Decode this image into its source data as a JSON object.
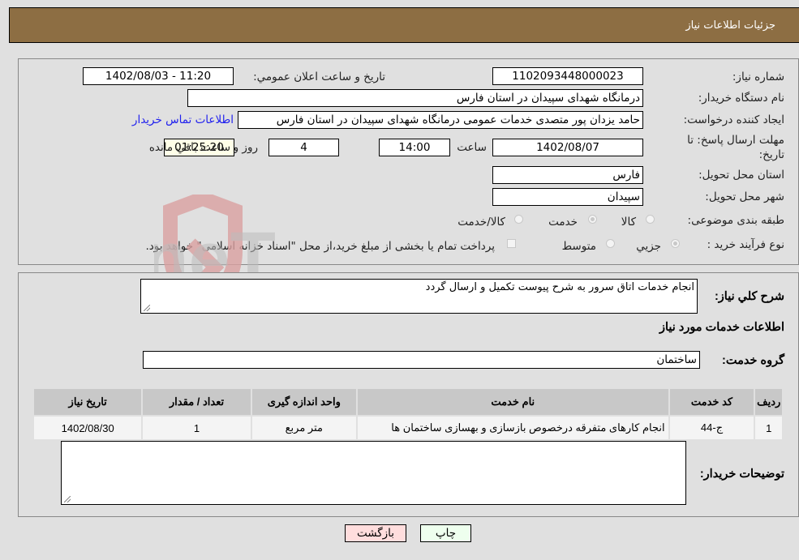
{
  "header": {
    "title": "جزئیات اطلاعات نیاز"
  },
  "details": {
    "need_number_label": "شماره نیاز:",
    "need_number": "1102093448000023",
    "announce_label": "تاریخ و ساعت اعلان عمومي:",
    "announce_value": "1402/08/03 - 11:20",
    "buyer_org_label": "نام دستگاه خریدار:",
    "buyer_org": "درمانگاه شهدای سپیدان در استان فارس",
    "creator_label": "ایجاد کننده درخواست:",
    "creator": "حامد یزدان پور متصدی خدمات عمومی درمانگاه شهدای سپیدان در استان فارس",
    "contact_link": "اطلاعات تماس خریدار",
    "deadline_label_1": "مهلت ارسال پاسخ: تا",
    "deadline_label_2": "تاریخ:",
    "deadline_date": "1402/08/07",
    "time_label": "ساعت",
    "deadline_time": "14:00",
    "days_value": "4",
    "days_label": "روز و",
    "remaining_time": "01:25:20",
    "remaining_label": "ساعت باقي مانده",
    "province_label": "استان محل تحویل:",
    "province": "فارس",
    "city_label": "شهر محل تحویل:",
    "city": "سپیدان",
    "category_label": "طبقه بندی موضوعی:",
    "category_options": [
      {
        "label": "کالا",
        "selected": false
      },
      {
        "label": "خدمت",
        "selected": true
      },
      {
        "label": "کالا/خدمت",
        "selected": false
      }
    ],
    "process_label": "نوع فرآیند خرید :",
    "process_options": [
      {
        "label": "جزیي",
        "selected": true
      },
      {
        "label": "متوسط",
        "selected": false
      }
    ],
    "treasury_note": "پرداخت تمام یا بخشی از مبلغ خرید،از محل \"اسناد خزانه اسلامی\" خواهد بود.",
    "treasury_checked": false
  },
  "description": {
    "label": "شرح کلي نیاز:",
    "value": "انجام خدمات اتاق سرور به شرح پیوست تکمیل و ارسال گردد"
  },
  "services": {
    "section_title": "اطلاعات خدمات مورد نیاز",
    "group_label": "گروه خدمت:",
    "group_value": "ساختمان",
    "columns": [
      "ردیف",
      "کد خدمت",
      "نام خدمت",
      "واحد اندازه گیری",
      "تعداد / مقدار",
      "تاریخ نیاز"
    ],
    "rows": [
      [
        "1",
        "ج-44",
        "انجام کارهای متفرقه درخصوص بازسازی و بهسازی ساختمان ها",
        "متر مربع",
        "1",
        "1402/08/30"
      ]
    ]
  },
  "buyer_notes": {
    "label": "توضیحات خریدار:",
    "value": ""
  },
  "buttons": {
    "print": "چاپ",
    "back": "بازگشت"
  },
  "watermark": {
    "text": "AriaTender.neT"
  },
  "colors": {
    "header_bg": "#8d6e43",
    "link": "#2020ee",
    "print_bg": "#eeffee",
    "back_bg": "#ffdddd"
  }
}
